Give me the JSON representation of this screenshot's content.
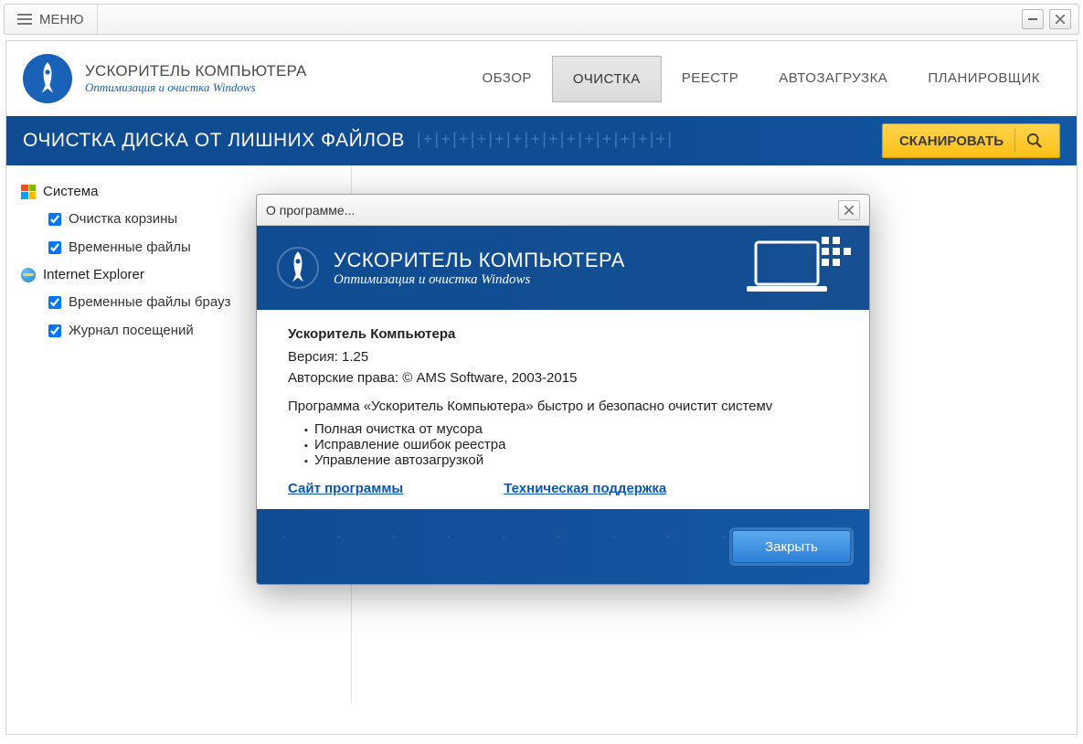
{
  "titlebar": {
    "menu_label": "МЕНЮ"
  },
  "brand": {
    "title": "УСКОРИТЕЛЬ КОМПЬЮТЕРА",
    "subtitle": "Оптимизация и очистка Windows"
  },
  "nav": {
    "overview": "ОБЗОР",
    "cleanup": "ОЧИСТКА",
    "registry": "РЕЕСТР",
    "startup": "АВТОЗАГРУЗКА",
    "scheduler": "ПЛАНИРОВЩИК"
  },
  "banner": {
    "title": "ОЧИСТКА ДИСКА ОТ ЛИШНИХ ФАЙЛОВ",
    "scan": "СКАНИРОВАТЬ"
  },
  "sidebar": {
    "system_label": "Система",
    "system_items": [
      "Очистка корзины",
      "Временные файлы"
    ],
    "ie_label": "Internet Explorer",
    "ie_items": [
      "Временные файлы брауз",
      "Журнал посещений"
    ]
  },
  "dialog": {
    "title": "О программе...",
    "banner_title": "УСКОРИТЕЛЬ КОМПЬЮТЕРА",
    "banner_sub": "Оптимизация и очистка Windows",
    "app_name": "Ускоритель Компьютера",
    "version": "Версия: 1.25",
    "copyright": "Авторские права: © AMS Software, 2003-2015",
    "description": "Программа «Ускоритель Компьютера» быстро и безопасно очистит системv",
    "features": [
      "Полная очистка от мусора",
      "Исправление ошибок реестра",
      "Управление автозагрузкой"
    ],
    "link_site": "Сайт программы",
    "link_support": "Техническая поддержка",
    "close": "Закрыть"
  }
}
